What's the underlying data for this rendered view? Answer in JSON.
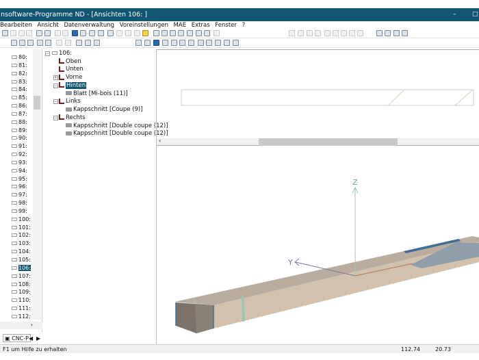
{
  "window": {
    "title": "nsoftware-Programme ND  - [Ansichten 106: ]",
    "minimize": "–",
    "maximize": "□"
  },
  "menu": [
    "Bearbeiten",
    "Ansicht",
    "Datenverwaltung",
    "Voreinstellungen",
    "MAE",
    "Extras",
    "Fenster",
    "?"
  ],
  "left_list": {
    "items": [
      "80:",
      "81:",
      "82:",
      "83:",
      "84:",
      "85:",
      "86:",
      "87:",
      "88:",
      "89:",
      "90:",
      "91:",
      "92:",
      "93:",
      "94:",
      "95:",
      "96:",
      "97:",
      "98:",
      "99:",
      "100:",
      "101:",
      "102:",
      "103:",
      "104:",
      "105:",
      "106:",
      "107:",
      "108:",
      "109:",
      "110:",
      "111:",
      "112:"
    ],
    "selected": "106:",
    "tab_label": "CNC-P"
  },
  "tree": {
    "root": "106:",
    "nodes": [
      {
        "label": "Oben",
        "level": 1,
        "type": "face"
      },
      {
        "label": "Unten",
        "level": 1,
        "type": "face"
      },
      {
        "label": "Vorne",
        "level": 1,
        "type": "face",
        "expander": "+"
      },
      {
        "label": "Hinten",
        "level": 1,
        "type": "face",
        "expander": "-",
        "selected": true
      },
      {
        "label": "Blatt [Mi-bois (11)]",
        "level": 2,
        "type": "op"
      },
      {
        "label": "Links",
        "level": 1,
        "type": "face",
        "expander": "-"
      },
      {
        "label": "Kappschnitt [Coupe (9)]",
        "level": 2,
        "type": "op"
      },
      {
        "label": "Rechts",
        "level": 1,
        "type": "face",
        "expander": "-"
      },
      {
        "label": "Kappschnitt [Double coupe (12)]",
        "level": 2,
        "type": "op"
      },
      {
        "label": "Kappschnitt [Double coupe (12)]",
        "level": 2,
        "type": "op"
      }
    ]
  },
  "view3d": {
    "axes": {
      "z": "Z",
      "y": "Y"
    }
  },
  "status": {
    "help": "F1  um Hilfe zu erhalten",
    "x": "112.74",
    "y": "20.73"
  },
  "colors": {
    "titlebar": "#125570",
    "beam_top": "#b9ad9f",
    "beam_side": "#d2c1ad",
    "beam_end": "#7b736a",
    "cut_blue": "#3f6e99"
  }
}
